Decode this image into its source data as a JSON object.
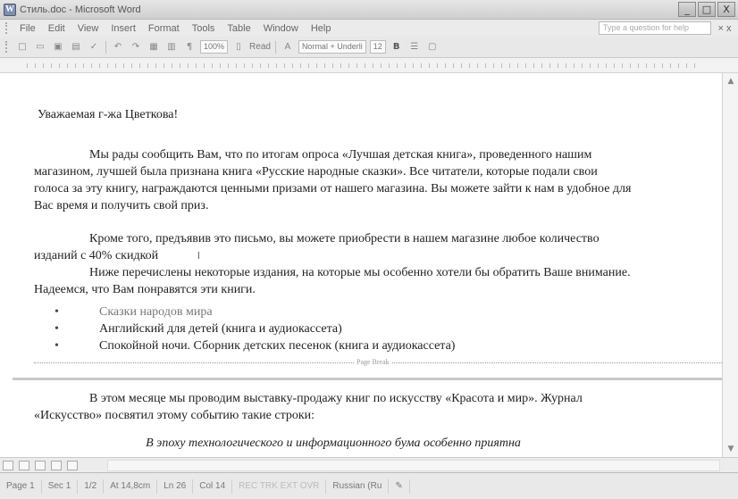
{
  "window": {
    "title": "Стиль.doc - Microsoft Word",
    "controls": [
      "_",
      "□",
      "X"
    ]
  },
  "menu": {
    "items": [
      "File",
      "Edit",
      "View",
      "Insert",
      "Format",
      "Tools",
      "Table",
      "Window",
      "Help"
    ],
    "help_placeholder": "Type a question for help",
    "close_glyph": "× x"
  },
  "toolbar": {
    "zoom": "100%",
    "read_label": "Read",
    "style": "Normal + Underli",
    "font_size": "12",
    "bold": "B"
  },
  "document": {
    "greeting": "Уважаемая г-жа Цветкова!",
    "para1": "Мы рады сообщить Вам, что по итогам опроса «Лучшая детская книга», проведенного нашим магазином, лучшей была признана книга «Русские народные сказки». Все читатели, которые подали свои голоса за эту книгу, награждаются ценными призами от нашего магазина. Вы можете зайти к нам в удобное для Вас время и получить свой приз.",
    "para2": "Кроме того, предъявив это письмо, вы можете приобрести в нашем магазине любое количество изданий с 40% скидкой",
    "cursor_glyph": "I",
    "para3": "Ниже перечислены некоторые издания, на которые мы особенно хотели бы обратить Ваше внимание. Надеемся, что Вам понравятся эти книги.",
    "list": [
      "Сказки народов мира",
      "Английский для детей (книга и аудиокассета)",
      "Спокойной ночи. Сборник детских песенок (книга и аудиокассета)"
    ],
    "page_break_label": "Page Break",
    "para4": "В этом месяце мы проводим выставку-продажу книг по искусству «Красота и мир». Журнал «Искусство» посвятил этому событию такие строки:",
    "quote": "В эпоху технологического и информационного бума особенно приятна"
  },
  "status": {
    "page": "Page 1",
    "section": "Sec 1",
    "page_of": "1/2",
    "at": "At 14,8cm",
    "line": "Ln 26",
    "col": "Col 14",
    "modes": "REC TRK EXT OVR",
    "language": "Russian (Ru"
  }
}
